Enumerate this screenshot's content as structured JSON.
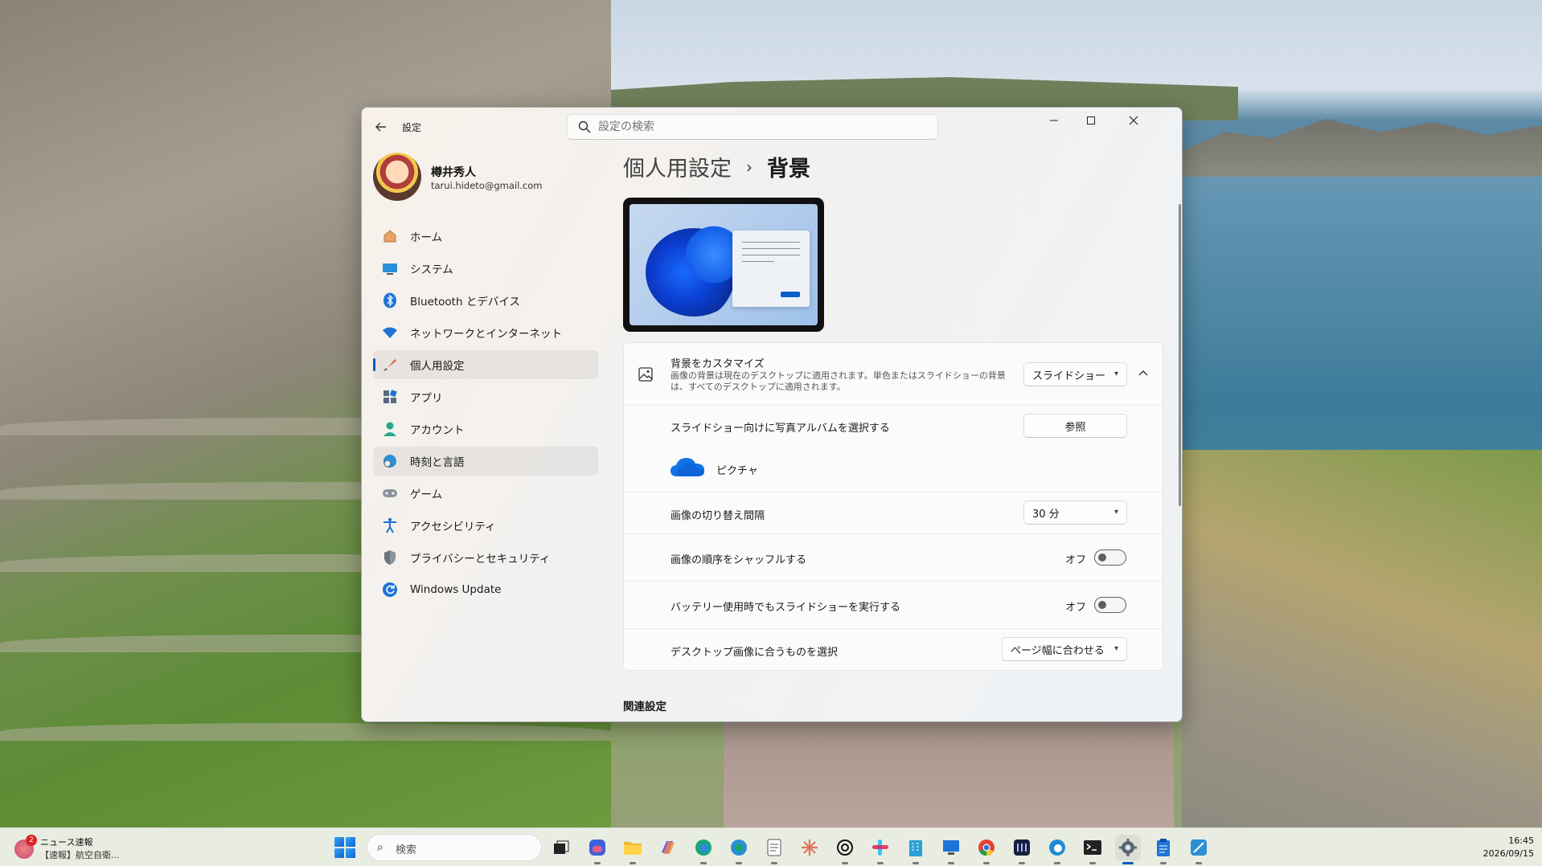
{
  "window": {
    "app_title": "設定",
    "search_placeholder": "設定の検索"
  },
  "profile": {
    "name": "樽井秀人",
    "email": "tarui.hideto@gmail.com"
  },
  "nav": [
    {
      "label": "ホーム",
      "icon": "home-icon"
    },
    {
      "label": "システム",
      "icon": "system-icon"
    },
    {
      "label": "Bluetooth とデバイス",
      "icon": "bluetooth-icon"
    },
    {
      "label": "ネットワークとインターネット",
      "icon": "wifi-icon"
    },
    {
      "label": "個人用設定",
      "icon": "brush-icon",
      "active": true
    },
    {
      "label": "アプリ",
      "icon": "apps-icon"
    },
    {
      "label": "アカウント",
      "icon": "account-icon"
    },
    {
      "label": "時刻と言語",
      "icon": "globe-clock-icon"
    },
    {
      "label": "ゲーム",
      "icon": "gamepad-icon"
    },
    {
      "label": "アクセシビリティ",
      "icon": "accessibility-icon"
    },
    {
      "label": "プライバシーとセキュリティ",
      "icon": "shield-icon"
    },
    {
      "label": "Windows Update",
      "icon": "update-icon"
    }
  ],
  "breadcrumb": {
    "parent": "個人用設定",
    "separator": "›",
    "current": "背景"
  },
  "background": {
    "customize_title": "背景をカスタマイズ",
    "customize_desc": "画像の背景は現在のデスクトップに適用されます。単色またはスライドショーの背景は、すべてのデスクトップに適用されます。",
    "type_value": "スライドショー",
    "album_label": "スライドショー向けに写真アルバムを選択する",
    "browse_label": "参照",
    "album_name": "ピクチャ",
    "interval_label": "画像の切り替え間隔",
    "interval_value": "30 分",
    "shuffle_label": "画像の順序をシャッフルする",
    "shuffle_state": "オフ",
    "battery_label": "バッテリー使用時でもスライドショーを実行する",
    "battery_state": "オフ",
    "fit_label": "デスクトップ画像に合うものを選択",
    "fit_value": "ページ幅に合わせる"
  },
  "related_heading": "関連設定",
  "taskbar": {
    "news_badge": "2",
    "news_title": "ニュース速報",
    "news_text": "【速報】航空自衛...",
    "search_label": "検索",
    "time": "16:45",
    "date": "2026/09/15"
  }
}
